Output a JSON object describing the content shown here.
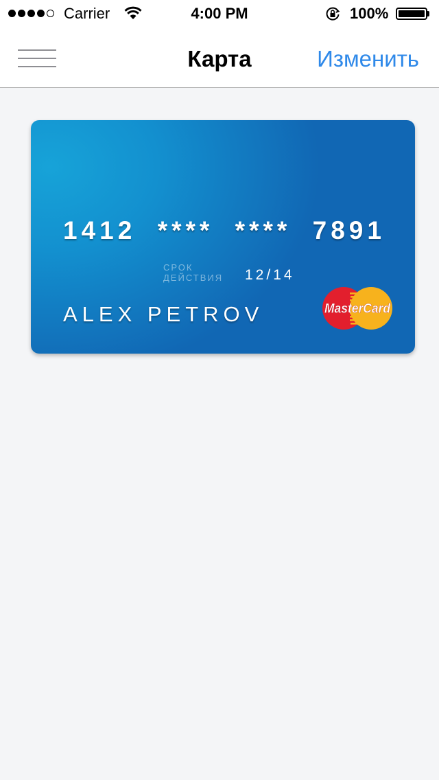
{
  "statusbar": {
    "carrier": "Carrier",
    "time": "4:00 PM",
    "battery_percent": "100%",
    "signal_bars": 4,
    "signal_max": 5,
    "icons": [
      "wifi-icon",
      "orientation-lock-icon",
      "battery-icon"
    ]
  },
  "navbar": {
    "title": "Карта",
    "edit_label": "Изменить",
    "menu_icon": "hamburger-menu-icon"
  },
  "card": {
    "number_groups": [
      "1412",
      "****",
      "****",
      "7891"
    ],
    "expiry_label_line1": "СРОК",
    "expiry_label_line2": "ДЕЙСТВИЯ",
    "expiry_value": "12/14",
    "holder_name": "ALEX PETROV",
    "brand_logo_text": "MasterCard",
    "colors": {
      "gradient_light": "#17a3d8",
      "gradient_dark": "#1167b4",
      "mc_red": "#e21f2d",
      "mc_yellow": "#f7b21d"
    }
  },
  "colors": {
    "accent": "#2f89e9",
    "background": "#f4f5f7"
  }
}
